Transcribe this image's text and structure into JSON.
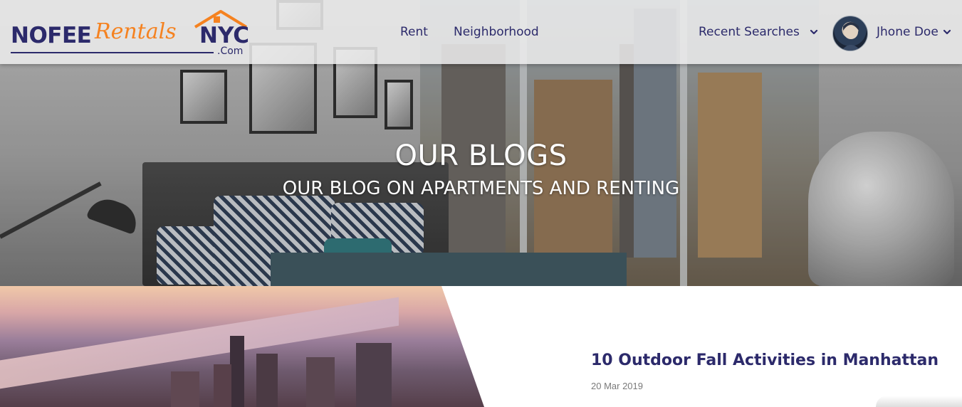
{
  "brand": {
    "logo_left": "NOFEE",
    "logo_script": "Rentals",
    "logo_right": "NYC",
    "logo_suffix": ".Com",
    "primary_color": "#2c2a6b",
    "accent_color": "#f58220"
  },
  "nav": {
    "links": [
      {
        "label": "Rent"
      },
      {
        "label": "Neighborhood"
      }
    ],
    "recent_searches_label": "Recent Searches",
    "user_name": "Jhone Doe",
    "chevron_icon": "chevron-down-icon",
    "avatar_icon": "user-avatar"
  },
  "hero": {
    "title": "OUR BLOGS",
    "subtitle": "OUR BLOG ON APARTMENTS AND RENTING"
  },
  "posts": [
    {
      "title": "10 Outdoor Fall Activities in Manhattan",
      "date": "20 Mar 2019"
    }
  ]
}
